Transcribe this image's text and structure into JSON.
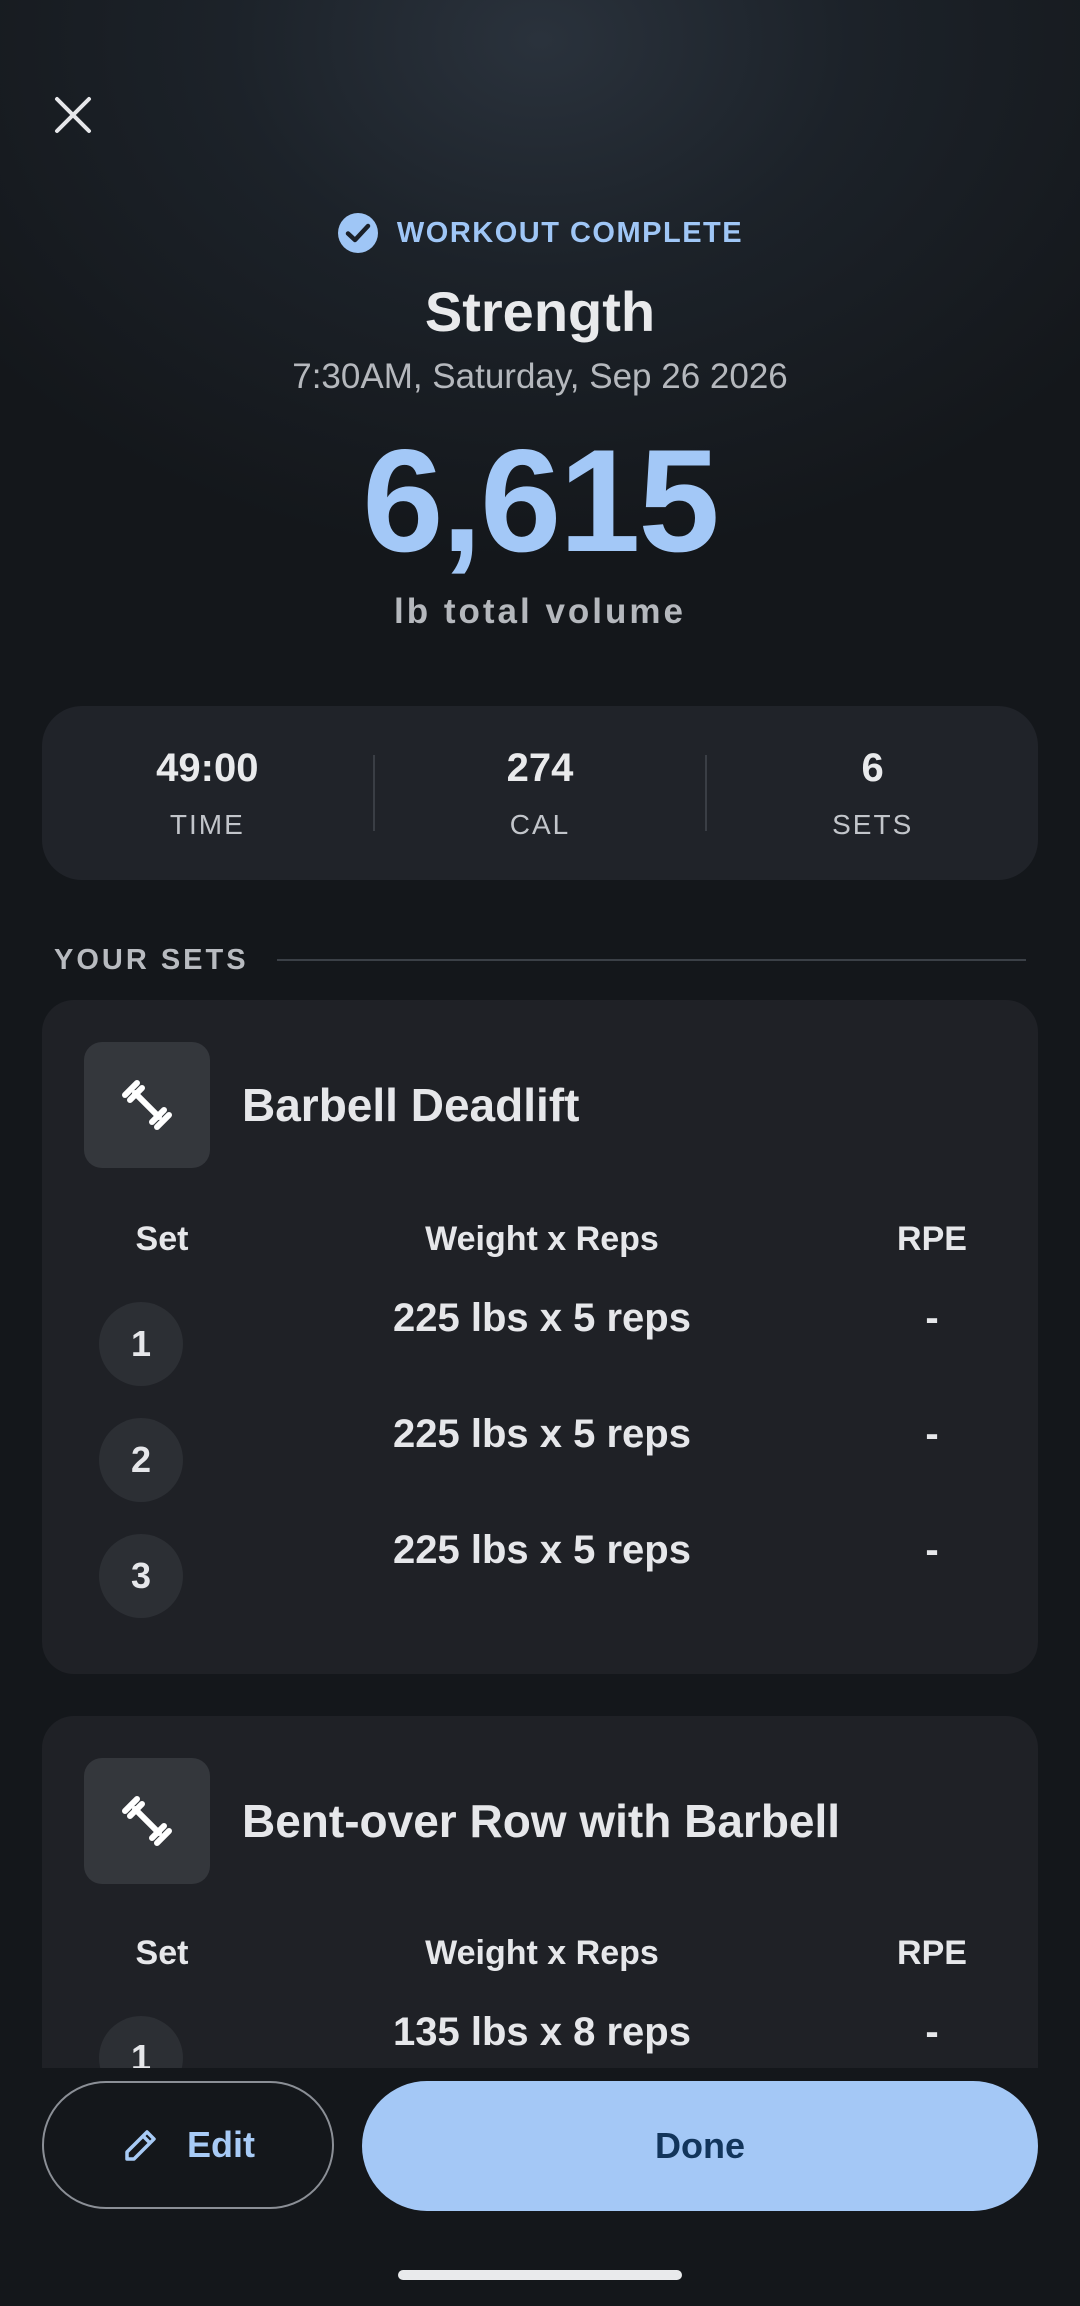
{
  "header": {
    "status": "WORKOUT COMPLETE",
    "title": "Strength",
    "datetime": "7:30AM, Saturday, Sep 26 2026",
    "volume": "6,615",
    "volume_unit": "lb total volume"
  },
  "stats": [
    {
      "value": "49:00",
      "label": "TIME"
    },
    {
      "value": "274",
      "label": "CAL"
    },
    {
      "value": "6",
      "label": "SETS"
    }
  ],
  "sets_section": {
    "title": "YOUR SETS"
  },
  "columns": {
    "set": "Set",
    "weight_reps": "Weight x Reps",
    "rpe": "RPE"
  },
  "exercises": [
    {
      "name": "Barbell Deadlift",
      "icon": "dumbbell-icon",
      "sets": [
        {
          "num": "1",
          "weight_reps": "225 lbs x 5 reps",
          "rpe": "-"
        },
        {
          "num": "2",
          "weight_reps": "225 lbs x 5 reps",
          "rpe": "-"
        },
        {
          "num": "3",
          "weight_reps": "225 lbs x 5 reps",
          "rpe": "-"
        }
      ]
    },
    {
      "name": "Bent-over Row with Barbell",
      "icon": "dumbbell-icon",
      "sets": [
        {
          "num": "1",
          "weight_reps": "135 lbs x 8 reps",
          "rpe": "-"
        }
      ]
    }
  ],
  "actions": {
    "edit": "Edit",
    "done": "Done"
  },
  "colors": {
    "accent": "#a4c8f6",
    "background": "#14171b",
    "card": "#1f2126"
  }
}
